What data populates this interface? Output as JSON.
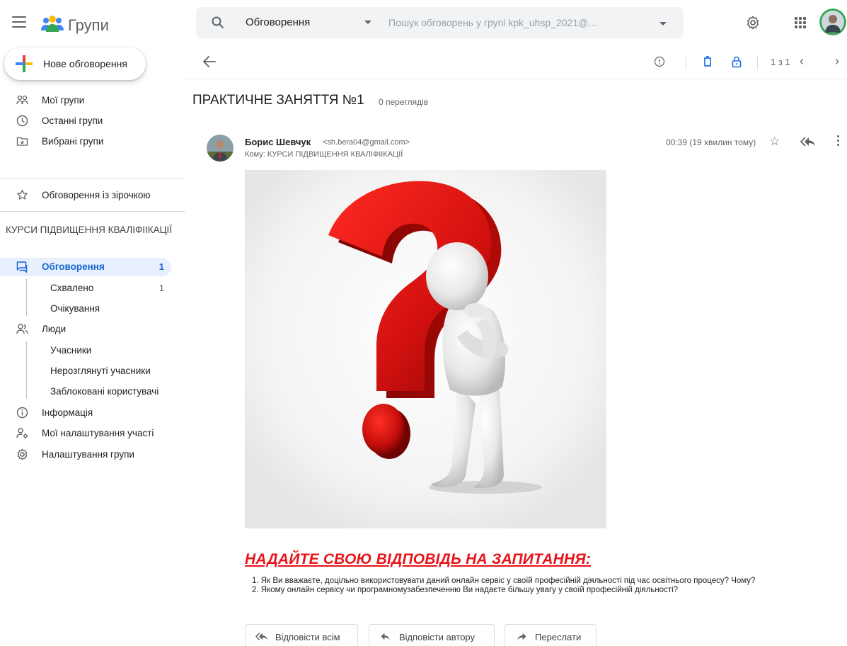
{
  "app": {
    "title": "Групи"
  },
  "search": {
    "scope": "Обговорення",
    "placeholder": "Пошук обговорень у групі kpk_uhsp_2021@..."
  },
  "compose": {
    "label": "Нове обговорення"
  },
  "sidebar": {
    "top_items": [
      {
        "label": "Мої групи",
        "icon": "groups-icon"
      },
      {
        "label": "Останні групи",
        "icon": "clock-icon"
      },
      {
        "label": "Вибрані групи",
        "icon": "folder-star-icon"
      }
    ],
    "starred": {
      "label": "Обговорення із зірочкою",
      "icon": "star-icon"
    },
    "group_name": "КУРСИ ПІДВИЩЕННЯ КВАЛІФІІКАЦІЇ",
    "items": [
      {
        "label": "Обговорення",
        "count": "1",
        "icon": "conversations-icon",
        "active": true
      },
      {
        "label": "Схвалено",
        "count": "1",
        "sub": true
      },
      {
        "label": "Очікування",
        "sub": true
      },
      {
        "label": "Люди",
        "icon": "people-icon"
      },
      {
        "label": "Учасники",
        "sub": true
      },
      {
        "label": "Нерозглянуті учасники",
        "sub": true
      },
      {
        "label": "Заблоковані користувачі",
        "sub": true
      },
      {
        "label": "Інформація",
        "icon": "info-icon"
      },
      {
        "label": "Мої налаштування участі",
        "icon": "member-settings-icon"
      },
      {
        "label": "Налаштування групи",
        "icon": "gear-icon"
      }
    ]
  },
  "toolbar": {
    "pager": "1 з 1",
    "prev": "‹",
    "next": "›"
  },
  "thread": {
    "title": "ПРАКТИЧНЕ ЗАНЯТТЯ №1",
    "views": "0 переглядів",
    "author": "Борис Шевчук",
    "email": "<sh.bera04@gmail.com>",
    "to": "Кому: КУРСИ ПІДВИЩЕННЯ КВАЛІФІІКАЦІЇ",
    "time": "00:39 (19 хвилин тому)",
    "star": "☆"
  },
  "body": {
    "heading": "НАДАЙТЕ СВОЮ ВІДПОВІДЬ НА ЗАПИТАННЯ:",
    "questions": [
      "1.  Як Ви вважаєте, доцільно використовувати даний онлайн сервіс у своїй професійній діяльності під час освітнього процесу? Чому?",
      "2.  Якому онлайн сервісу чи програмномузабезпеченню Ви надаєте більшу увагу у своїй професійній діяльності?"
    ]
  },
  "actions": {
    "reply_all": "Відповісти всім",
    "reply_author": "Відповісти автору",
    "forward": "Переслати"
  },
  "colors": {
    "accent": "#1967d2",
    "heading_red": "#e8141a",
    "active_bg": "#e8f0fe"
  }
}
